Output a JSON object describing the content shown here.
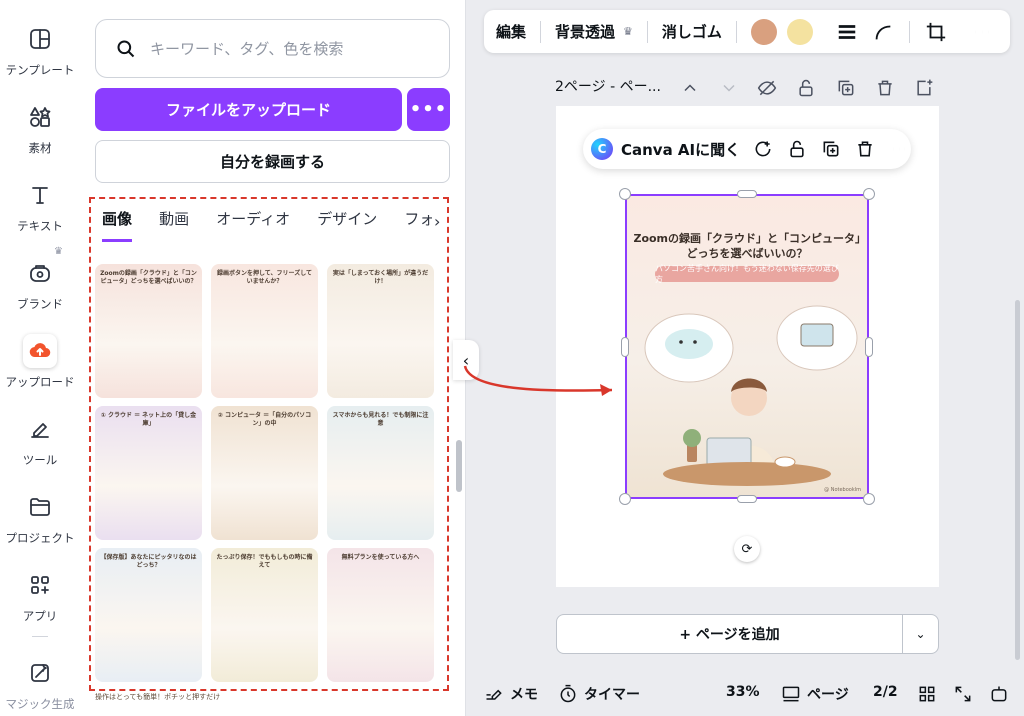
{
  "rail": {
    "items": [
      {
        "label": "テンプレート",
        "icon": "template-icon"
      },
      {
        "label": "素材",
        "icon": "elements-icon"
      },
      {
        "label": "テキスト",
        "icon": "text-icon"
      },
      {
        "label": "ブランド",
        "icon": "brand-icon"
      },
      {
        "label": "アップロード",
        "icon": "upload-icon"
      },
      {
        "label": "ツール",
        "icon": "tools-icon"
      },
      {
        "label": "プロジェクト",
        "icon": "folder-icon"
      },
      {
        "label": "アプリ",
        "icon": "apps-icon"
      },
      {
        "label": "マジック生成",
        "icon": "magic-icon"
      }
    ]
  },
  "panel": {
    "search_placeholder": "キーワード、タグ、色を検索",
    "upload_label": "ファイルをアップロード",
    "more_label": "•••",
    "record_label": "自分を録画する",
    "tabs": [
      "画像",
      "動画",
      "オーディオ",
      "デザイン",
      "フォルダー"
    ],
    "tabs_arrow": "›",
    "thumbs": [
      {
        "title": "Zoomの録画「クラウド」と「コンピュータ」どっちを選べばいいの？",
        "bg": "#f6e2dc"
      },
      {
        "title": "録画ボタンを押して、フリーズしていませんか？",
        "bg": "#f8e6df"
      },
      {
        "title": "実は「しまっておく場所」が違うだけ！",
        "bg": "#f3ebe0"
      },
      {
        "title": "① クラウド ＝ ネット上の「貸し金庫」",
        "bg": "#eadff0"
      },
      {
        "title": "② コンピュータ ＝「自分のパソコン」の中",
        "bg": "#f0e2d2"
      },
      {
        "title": "スマホからも見れる！でも制限に注意",
        "bg": "#e6eef0"
      },
      {
        "title": "【保存版】あなたにピッタリなのはどっち？",
        "bg": "#e8eef4"
      },
      {
        "title": "たっぷり保存！でももしもの時に備えて",
        "bg": "#f2ecd8"
      },
      {
        "title": "無料プランを使っている方へ",
        "bg": "#f4e4e8"
      }
    ],
    "bottom_text": "操作はとっても簡単！ポチッと押すだけ"
  },
  "toolbar": {
    "edit": "編集",
    "bg_remove": "背景透過",
    "eraser": "消しゴム",
    "colors": [
      "#d9a07f",
      "#f4e2a0"
    ]
  },
  "page_header": {
    "label": "2ページ - ペー..."
  },
  "ai_bar": {
    "label": "Canva AIに聞く",
    "logo": "C"
  },
  "image": {
    "title": "Zoomの録画「クラウド」と「コンピュータ」どっちを選べばいいの？",
    "subtitle": "パソコン苦手さん向け！もう迷わない保存先の選び方",
    "credit": "@ Notebooklm"
  },
  "add_page": {
    "label": "+ ページを追加",
    "caret": "⌄"
  },
  "footer": {
    "memo": "メモ",
    "timer": "タイマー",
    "zoom": "33%",
    "pages_label": "ページ",
    "page_count": "2/2"
  }
}
